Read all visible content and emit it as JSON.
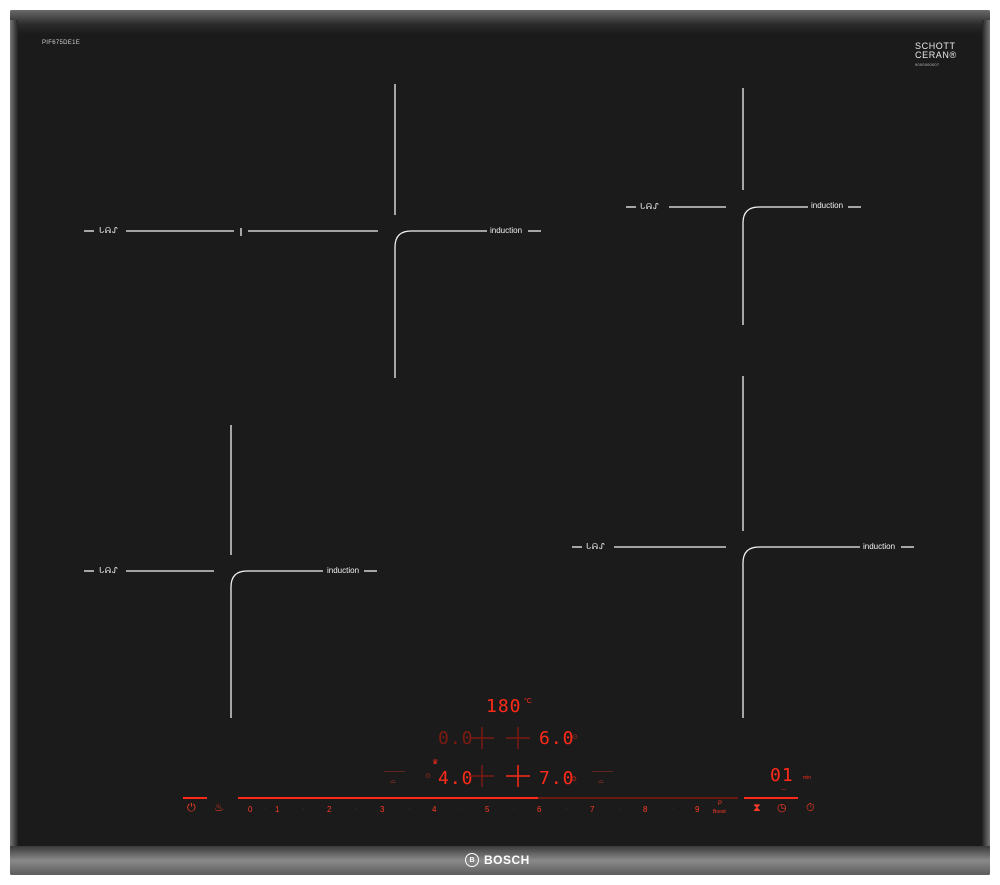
{
  "model_code": "PIF675DE1E",
  "glass_brand": {
    "line1": "SCHOTT",
    "line2": "CERAN",
    "mark": "®",
    "serial": "9000000007"
  },
  "zones": [
    {
      "label": "induction",
      "symbol": "ᒐᕱᔑ"
    },
    {
      "label": "induction",
      "symbol": "ᒐᕱᔑ"
    },
    {
      "label": "induction",
      "symbol": "ᒐᕱᔑ"
    },
    {
      "label": "induction",
      "symbol": "ᒐᕱᔑ"
    }
  ],
  "display": {
    "temperature": "180",
    "temperature_unit": "°C",
    "rear_left_level": "0.0",
    "rear_right_level": "6.0",
    "front_left_level": "4.0",
    "front_right_level": "7.0",
    "timer": "01",
    "timer_unit": "min"
  },
  "power_slider": {
    "numbers": [
      "0",
      "1",
      "2",
      "3",
      "4",
      "5",
      "6",
      "7",
      "8",
      "9"
    ],
    "boost_symbol": "P",
    "boost_label": "Boost",
    "fill_fraction": 0.6
  },
  "controls": {
    "power_icon": "power-icon",
    "child_lock_icon": "childlock-icon",
    "timer_icons": [
      "hourglass-icon",
      "timer-icon",
      "stopwatch-icon"
    ]
  },
  "brand": {
    "name": "BOSCH",
    "logo_letter": "B"
  },
  "colors": {
    "glass": "#1b1b1b",
    "display_red": "#ff2a18",
    "print_white": "#f2f2f2"
  }
}
